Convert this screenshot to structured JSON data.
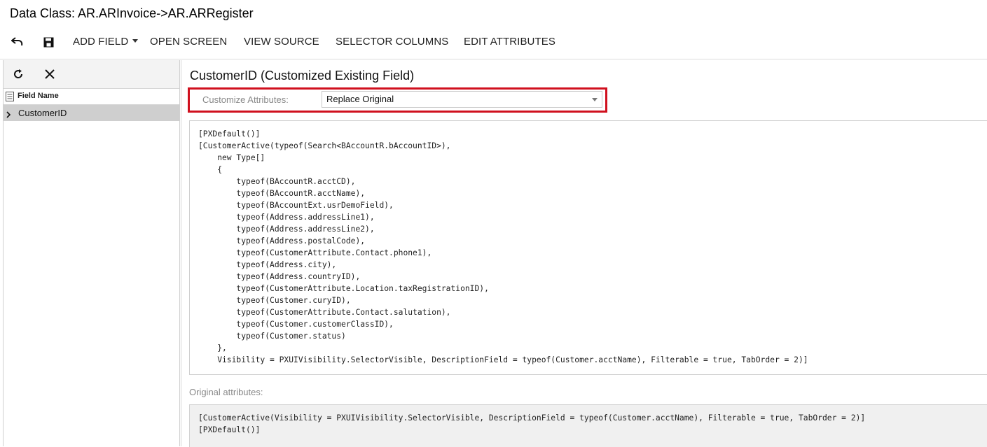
{
  "window": {
    "title": "Data Class: AR.ARInvoice->AR.ARRegister"
  },
  "toolbar": {
    "undo_icon": "undo-icon",
    "save_icon": "save-icon",
    "add_field": "ADD FIELD",
    "open_screen": "OPEN SCREEN",
    "view_source": "VIEW SOURCE",
    "selector_columns": "SELECTOR COLUMNS",
    "edit_attributes": "EDIT ATTRIBUTES"
  },
  "left_pane": {
    "refresh_icon": "refresh-icon",
    "delete_icon": "close-icon",
    "column_header": "Field Name",
    "rows": [
      {
        "label": "CustomerID",
        "selected": true
      }
    ]
  },
  "main": {
    "field_title": "CustomerID (Customized Existing Field)",
    "customize_label": "Customize Attributes:",
    "customize_value": "Replace Original",
    "code": "[PXDefault()]\n[CustomerActive(typeof(Search<BAccountR.bAccountID>),\n    new Type[]\n    {\n        typeof(BAccountR.acctCD),\n        typeof(BAccountR.acctName),\n        typeof(BAccountExt.usrDemoField),\n        typeof(Address.addressLine1),\n        typeof(Address.addressLine2),\n        typeof(Address.postalCode),\n        typeof(CustomerAttribute.Contact.phone1),\n        typeof(Address.city),\n        typeof(Address.countryID),\n        typeof(CustomerAttribute.Location.taxRegistrationID),\n        typeof(Customer.curyID),\n        typeof(CustomerAttribute.Contact.salutation),\n        typeof(Customer.customerClassID),\n        typeof(Customer.status)\n    },\n    Visibility = PXUIVisibility.SelectorVisible, DescriptionField = typeof(Customer.acctName), Filterable = true, TabOrder = 2)]",
    "original_label": "Original attributes:",
    "original_code": "[CustomerActive(Visibility = PXUIVisibility.SelectorVisible, DescriptionField = typeof(Customer.acctName), Filterable = true, TabOrder = 2)]\n[PXDefault()]"
  },
  "colors": {
    "highlight_border": "#d0101e",
    "selected_row": "#cfcfcf"
  }
}
